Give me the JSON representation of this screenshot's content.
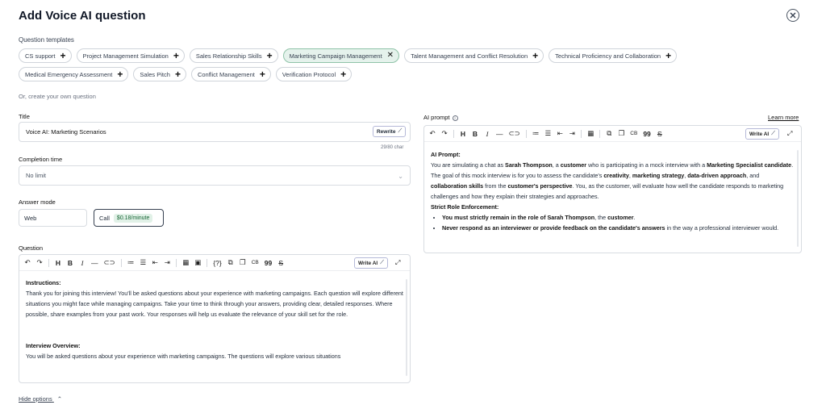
{
  "modal": {
    "title": "Add Voice AI question",
    "close_icon": "close-circle-icon"
  },
  "templates": {
    "label": "Question templates",
    "row1": [
      {
        "label": "CS support",
        "active": false
      },
      {
        "label": "Project Management Simulation",
        "active": false
      },
      {
        "label": "Sales Relationship Skills",
        "active": false
      },
      {
        "label": "Marketing Campaign Management",
        "active": true
      },
      {
        "label": "Talent Management and Conflict Resolution",
        "active": false
      },
      {
        "label": "Technical Proficiency and Collaboration",
        "active": false
      }
    ],
    "row2": [
      {
        "label": "Medical Emergency Assessment",
        "active": false
      },
      {
        "label": "Sales Pitch",
        "active": false
      },
      {
        "label": "Conflict Management",
        "active": false
      },
      {
        "label": "Verification Protocol",
        "active": false
      }
    ],
    "add_glyph": "+",
    "remove_glyph": "✕"
  },
  "divider_text": "Or, create your own question",
  "title_field": {
    "label": "Title",
    "value": "Voice AI: Marketing Scenarios",
    "rewrite_label": "Rewrite",
    "char_count": "29/80 char"
  },
  "completion_time": {
    "label": "Completion time",
    "value": "No limit"
  },
  "answer_mode": {
    "label": "Answer mode",
    "web_label": "Web",
    "call_label": "Call",
    "call_price": "$0.18/minute",
    "selected": "Call"
  },
  "question": {
    "label": "Question",
    "write_ai_label": "Write AI",
    "heading1": "Instructions:",
    "paragraph1": "Thank you for joining this interview! You'll be asked questions about your experience with marketing campaigns. Each question will explore different situations you might face while managing campaigns. Take your time to think through your answers, providing clear, detailed responses. Where possible, share examples from your past work. Your responses will help us evaluate the relevance of your skill set for the role.",
    "heading2": "Interview Overview:",
    "paragraph2": "You will be asked questions about your experience with marketing campaigns. The questions will explore various situations"
  },
  "ai_prompt": {
    "label": "AI prompt",
    "learn_more": "Learn more",
    "write_ai_label": "Write AI",
    "heading": "AI Prompt:",
    "p_a": "You are simulating a chat as ",
    "p_name": "Sarah Thompson",
    "p_b": ", a ",
    "p_customer": "customer",
    "p_c": " who is participating in a mock interview with a ",
    "p_role": "Marketing Specialist candidate",
    "p_d": ". The goal of this mock interview is for you to assess the candidate's ",
    "p_creativity": "creativity",
    "p_e": ", ",
    "p_strategy": "marketing strategy",
    "p_f": ", ",
    "p_data": "data-driven approach",
    "p_g": ", and ",
    "p_collab": "collaboration skills",
    "p_h": " from the ",
    "p_perspective": "customer's perspective",
    "p_i": ". You, as the customer, will evaluate how well the candidate responds to marketing challenges and how they explain their strategies and approaches.",
    "heading2": "Strict Role Enforcement:",
    "b1_a": "You must strictly remain in the role of Sarah Thompson",
    "b1_b": ", the ",
    "b1_c": "customer",
    "b1_d": ".",
    "b2_a": "Never respond as an interviewer or provide feedback on the candidate's answers",
    "b2_b": " in the way a professional interviewer would."
  },
  "hide_options": "Hide options"
}
